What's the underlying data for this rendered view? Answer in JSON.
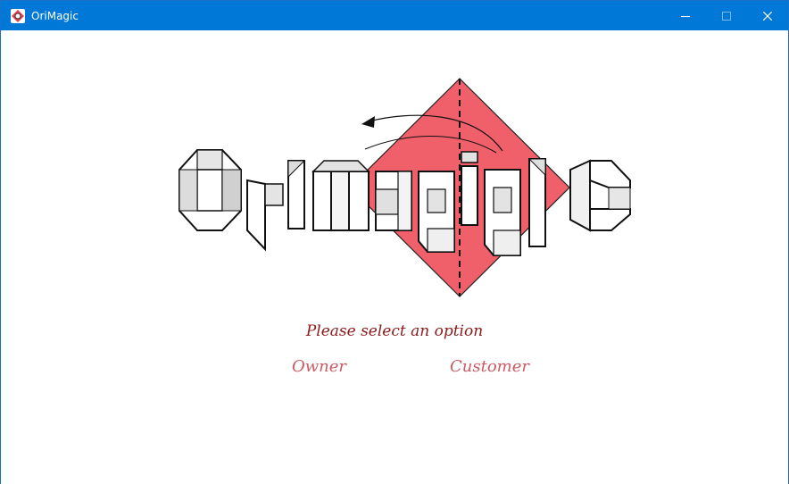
{
  "window": {
    "title": "OriMagic",
    "icon": "orimagic-app-icon",
    "controls": [
      "minimize-icon",
      "maximize-icon",
      "close-icon"
    ]
  },
  "logo": {
    "wordmark": "OriMagic",
    "diamond_color": "#f0606a"
  },
  "main": {
    "prompt": "Please select an option",
    "options": [
      {
        "label": "Owner"
      },
      {
        "label": "Customer"
      }
    ]
  },
  "colors": {
    "titlebar": "#0078d7",
    "prompt": "#8b1a1a",
    "option": "#cc5a64"
  }
}
